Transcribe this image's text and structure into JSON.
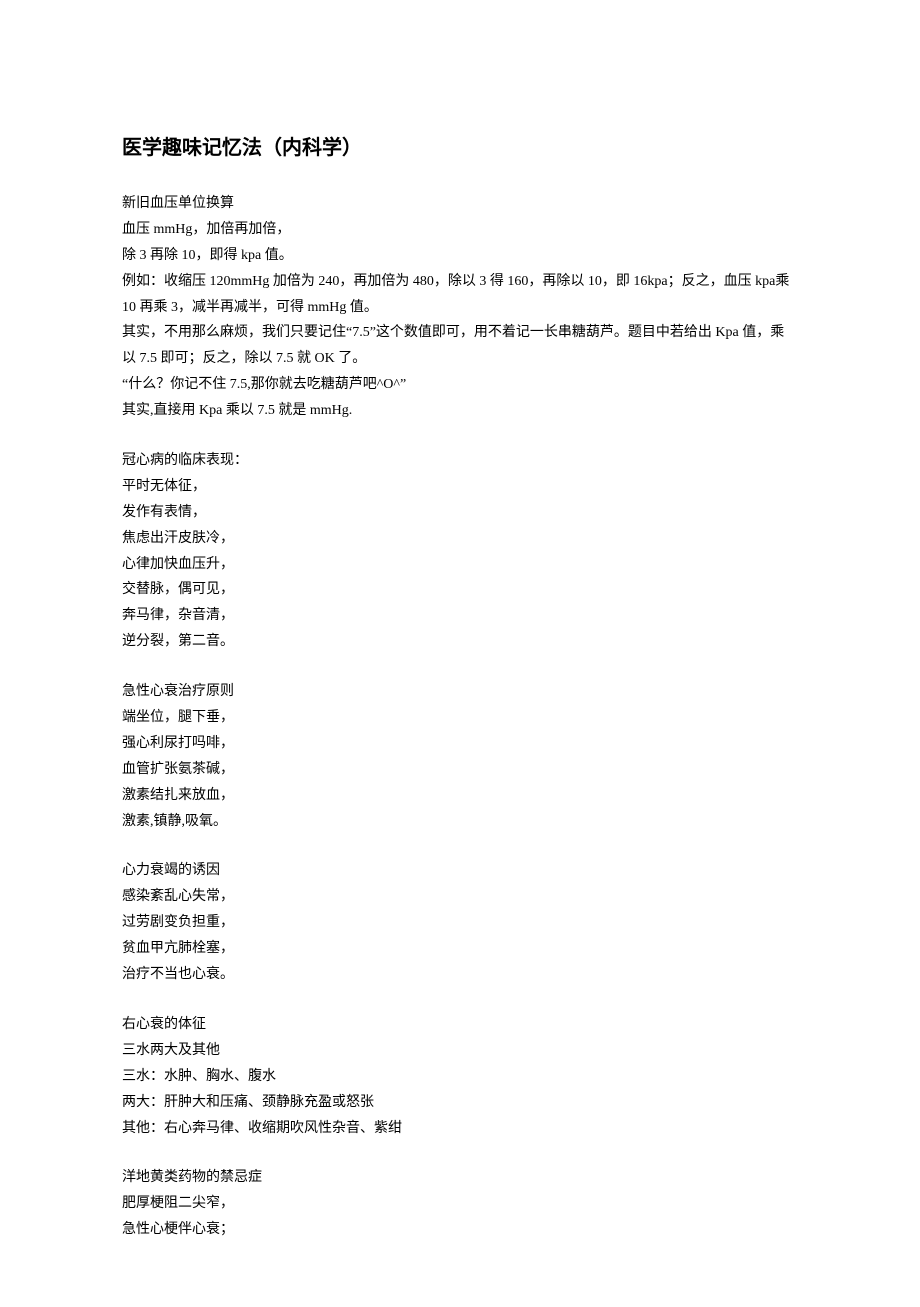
{
  "title": "医学趣味记忆法（内科学）",
  "sections": [
    {
      "lines": [
        "新旧血压单位换算",
        "血压 mmHg，加倍再加倍，",
        "除 3 再除 10，即得 kpa 值。",
        "例如：收缩压 120mmHg 加倍为 240，再加倍为 480，除以 3 得 160，再除以 10，即 16kpa；反之，血压 kpa乘 10 再乘 3，减半再减半，可得 mmHg 值。",
        "其实，不用那么麻烦，我们只要记住“7.5”这个数值即可，用不着记一长串糖葫芦。题目中若给出 Kpa 值，乘以 7.5 即可；反之，除以 7.5 就 OK 了。",
        "“什么？你记不住 7.5,那你就去吃糖葫芦吧^O^”",
        "其实,直接用 Kpa 乘以 7.5 就是 mmHg."
      ]
    },
    {
      "lines": [
        "冠心病的临床表现：",
        "平时无体征，",
        "发作有表情，",
        "焦虑出汗皮肤冷，",
        "心律加快血压升，",
        "交替脉，偶可见，",
        "奔马律，杂音清，",
        "逆分裂，第二音。"
      ]
    },
    {
      "lines": [
        "急性心衰治疗原则",
        "端坐位，腿下垂，",
        "强心利尿打吗啡，",
        "血管扩张氨茶碱，",
        "激素结扎来放血，",
        "激素,镇静,吸氧。"
      ]
    },
    {
      "lines": [
        "心力衰竭的诱因",
        "感染紊乱心失常，",
        "过劳剧变负担重，",
        "贫血甲亢肺栓塞，",
        "治疗不当也心衰。"
      ]
    },
    {
      "lines": [
        "右心衰的体征",
        "三水两大及其他",
        "三水：水肿、胸水、腹水",
        "两大：肝肿大和压痛、颈静脉充盈或怒张",
        "其他：右心奔马律、收缩期吹风性杂音、紫绀"
      ]
    },
    {
      "lines": [
        "洋地黄类药物的禁忌症",
        "肥厚梗阻二尖窄，",
        "急性心梗伴心衰；"
      ]
    }
  ]
}
